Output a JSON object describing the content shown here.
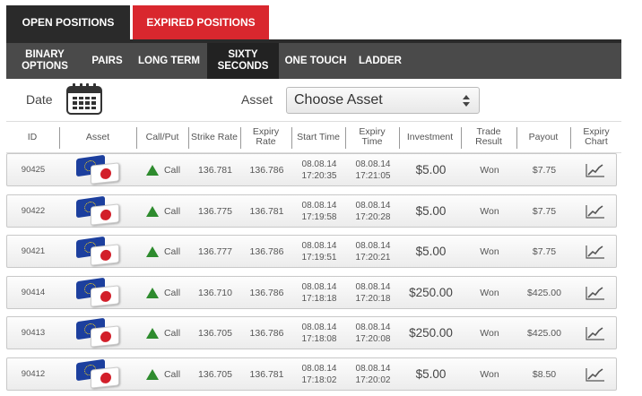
{
  "top_tabs": [
    {
      "label": "OPEN POSITIONS"
    },
    {
      "label": "EXPIRED POSITIONS"
    }
  ],
  "sub_nav": [
    {
      "label": "BINARY OPTIONS"
    },
    {
      "label": "PAIRS"
    },
    {
      "label": "LONG TERM"
    },
    {
      "label": "SIXTY SECONDS"
    },
    {
      "label": "ONE TOUCH"
    },
    {
      "label": "LADDER"
    }
  ],
  "filter": {
    "date_label": "Date",
    "asset_label": "Asset",
    "asset_select_value": "Choose Asset"
  },
  "columns": [
    "ID",
    "Asset",
    "Call/Put",
    "Strike Rate",
    "Expiry Rate",
    "Start Time",
    "Expiry Time",
    "Investment",
    "Trade Result",
    "Payout",
    "Expiry Chart"
  ],
  "rows": [
    {
      "id": "90425",
      "asset_icon": "eur-jpy-flags-icon",
      "direction": "Call",
      "strike": "136.781",
      "expiry_rate": "136.786",
      "start_date": "08.08.14",
      "start_time": "17:20:35",
      "expiry_date": "08.08.14",
      "expiry_time": "17:21:05",
      "investment": "$5.00",
      "result": "Won",
      "payout": "$7.75",
      "chart_icon": "line-chart-icon"
    },
    {
      "id": "90422",
      "asset_icon": "eur-jpy-flags-icon",
      "direction": "Call",
      "strike": "136.775",
      "expiry_rate": "136.781",
      "start_date": "08.08.14",
      "start_time": "17:19:58",
      "expiry_date": "08.08.14",
      "expiry_time": "17:20:28",
      "investment": "$5.00",
      "result": "Won",
      "payout": "$7.75",
      "chart_icon": "line-chart-icon"
    },
    {
      "id": "90421",
      "asset_icon": "eur-jpy-flags-icon",
      "direction": "Call",
      "strike": "136.777",
      "expiry_rate": "136.786",
      "start_date": "08.08.14",
      "start_time": "17:19:51",
      "expiry_date": "08.08.14",
      "expiry_time": "17:20:21",
      "investment": "$5.00",
      "result": "Won",
      "payout": "$7.75",
      "chart_icon": "line-chart-icon"
    },
    {
      "id": "90414",
      "asset_icon": "eur-jpy-flags-icon",
      "direction": "Call",
      "strike": "136.710",
      "expiry_rate": "136.786",
      "start_date": "08.08.14",
      "start_time": "17:18:18",
      "expiry_date": "08.08.14",
      "expiry_time": "17:20:18",
      "investment": "$250.00",
      "result": "Won",
      "payout": "$425.00",
      "chart_icon": "line-chart-icon"
    },
    {
      "id": "90413",
      "asset_icon": "eur-jpy-flags-icon",
      "direction": "Call",
      "strike": "136.705",
      "expiry_rate": "136.786",
      "start_date": "08.08.14",
      "start_time": "17:18:08",
      "expiry_date": "08.08.14",
      "expiry_time": "17:20:08",
      "investment": "$250.00",
      "result": "Won",
      "payout": "$425.00",
      "chart_icon": "line-chart-icon"
    },
    {
      "id": "90412",
      "asset_icon": "eur-jpy-flags-icon",
      "direction": "Call",
      "strike": "136.705",
      "expiry_rate": "136.781",
      "start_date": "08.08.14",
      "start_time": "17:18:02",
      "expiry_date": "08.08.14",
      "expiry_time": "17:20:02",
      "investment": "$5.00",
      "result": "Won",
      "payout": "$8.50",
      "chart_icon": "line-chart-icon"
    }
  ],
  "colors": {
    "dark_tab": "#2a2a2a",
    "active_tab": "#d9272e",
    "sub_nav_bg": "#4a4a4a",
    "sub_nav_active": "#222222",
    "call_arrow": "#2e8b2e"
  }
}
